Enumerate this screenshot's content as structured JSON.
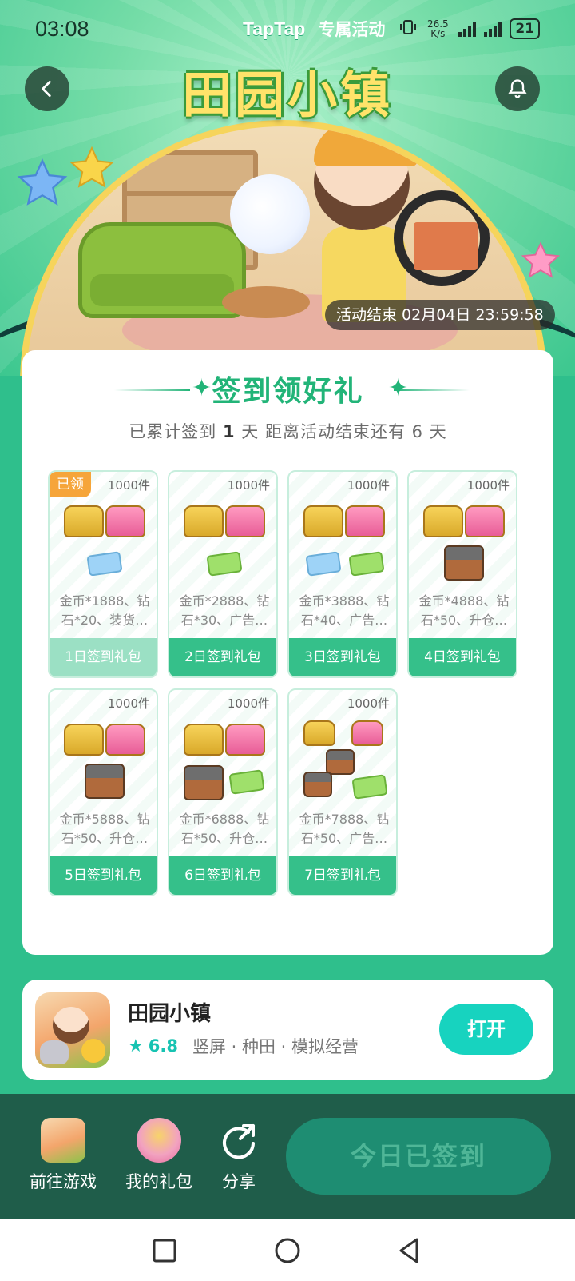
{
  "status_bar": {
    "time": "03:08",
    "brand": "TapTap",
    "brand_tag": "专属活动",
    "net_speed_value": "26.5",
    "net_speed_unit": "K/s",
    "battery": "21"
  },
  "hero": {
    "game_title": "田园小镇",
    "end_time": "活动结束 02月04日 23:59:58"
  },
  "checkin": {
    "title": "签到领好礼",
    "summary_prefix": "已累计签到",
    "days_checked": "1",
    "summary_mid": "天  距离活动结束还有",
    "days_left": "6",
    "summary_suffix": "天"
  },
  "gifts": [
    {
      "qty": "1000件",
      "badge": "已领",
      "desc": "金币*1888、钻石*20、装货…",
      "button": "1日签到礼包"
    },
    {
      "qty": "1000件",
      "badge": "",
      "desc": "金币*2888、钻石*30、广告…",
      "button": "2日签到礼包"
    },
    {
      "qty": "1000件",
      "badge": "",
      "desc": "金币*3888、钻石*40、广告…",
      "button": "3日签到礼包"
    },
    {
      "qty": "1000件",
      "badge": "",
      "desc": "金币*4888、钻石*50、升仓…",
      "button": "4日签到礼包"
    },
    {
      "qty": "1000件",
      "badge": "",
      "desc": "金币*5888、钻石*50、升仓…",
      "button": "5日签到礼包"
    },
    {
      "qty": "1000件",
      "badge": "",
      "desc": "金币*6888、钻石*50、升仓…",
      "button": "6日签到礼包"
    },
    {
      "qty": "1000件",
      "badge": "",
      "desc": "金币*7888、钻石*50、广告…",
      "button": "7日签到礼包"
    }
  ],
  "game_card": {
    "name": "田园小镇",
    "rating": "6.8",
    "tags": "竖屏 · 种田 · 模拟经营",
    "open_label": "打开"
  },
  "action_bar": {
    "goto_game": "前往游戏",
    "my_gifts": "我的礼包",
    "share": "分享",
    "checkin_button": "今日已签到"
  },
  "colors": {
    "accent": "#22b478",
    "button": "#35c08a",
    "open_button": "#17d3bf",
    "claimed_badge": "#f6a53a"
  }
}
